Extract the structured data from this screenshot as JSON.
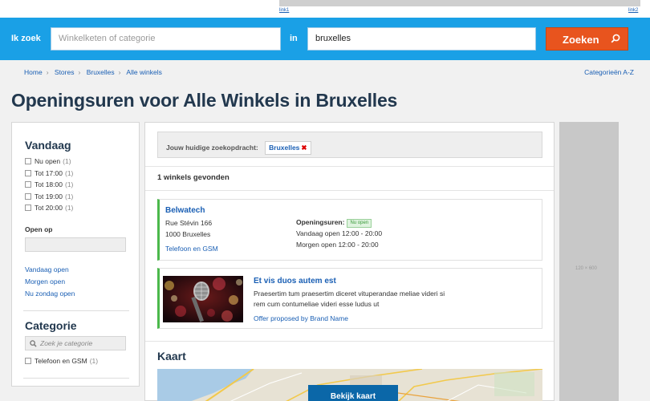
{
  "topbar": {
    "link_left": "link1",
    "link_right": "link2"
  },
  "search": {
    "label_what": "Ik zoek",
    "what_placeholder": "Winkelketen of categorie",
    "label_where": "in",
    "where_value": "bruxelles",
    "button": "Zoeken"
  },
  "breadcrumb": [
    "Home",
    "Stores",
    "Bruxelles",
    "Alle winkels"
  ],
  "categories_link": "Categorieën A-Z",
  "page_title": "Openingsuren voor Alle Winkels in Bruxelles",
  "sidebar": {
    "today_heading": "Vandaag",
    "today_filters": [
      {
        "label": "Nu open",
        "count": "(1)"
      },
      {
        "label": "Tot 17:00",
        "count": "(1)"
      },
      {
        "label": "Tot 18:00",
        "count": "(1)"
      },
      {
        "label": "Tot 19:00",
        "count": "(1)"
      },
      {
        "label": "Tot 20:00",
        "count": "(1)"
      }
    ],
    "open_on_label": "Open op",
    "quick_links": [
      "Vandaag open",
      "Morgen open",
      "Nu zondag open"
    ],
    "category_heading": "Categorie",
    "category_search_placeholder": "Zoek je categorie",
    "category_filters": [
      {
        "label": "Telefoon en GSM",
        "count": "(1)"
      }
    ]
  },
  "main": {
    "query_label": "Jouw huidige zoekopdracht:",
    "query_tag": "Bruxelles",
    "query_tag_remove": "✖",
    "results_count": "1 winkels gevonden",
    "store": {
      "name": "Belwatech",
      "street": "Rue Stévin 166",
      "city": "1000 Bruxelles",
      "category": "Telefoon en GSM",
      "hours_label": "Openingsuren:",
      "status_badge": "Nu open",
      "today": "Vandaag open 12:00 - 20:00",
      "tomorrow": "Morgen open 12:00 - 20:00"
    },
    "promo": {
      "title": "Et vis duos autem est",
      "text": "Praesertim tum praesertim diceret vituperandae meliae videri si rem cum contumeliae videri esse ludus ut",
      "offer": "Offer proposed by Brand Name"
    },
    "map_heading": "Kaart",
    "map_button": "Bekijk kaart"
  },
  "right_ad": {
    "size_label": "120 × 600"
  },
  "colors": {
    "search_bar": "#1aa0e6",
    "search_button": "#e8541e",
    "link": "#1a5fb4",
    "heading": "#22384e",
    "open_accent": "#4bb84b"
  }
}
